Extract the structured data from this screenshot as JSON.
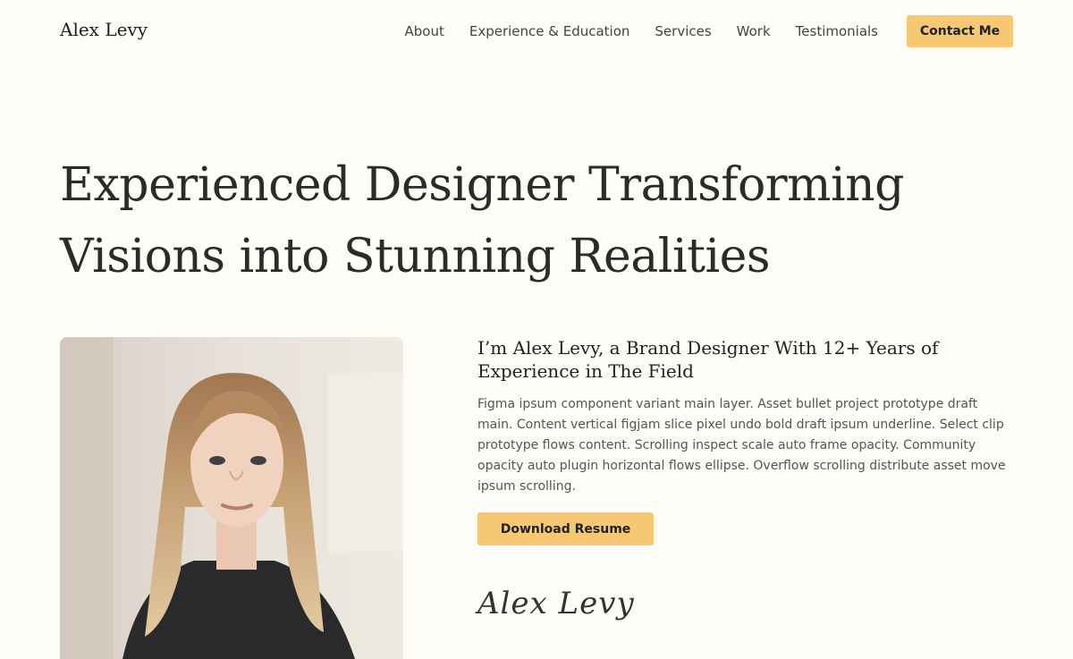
{
  "header": {
    "logo": "Alex Levy",
    "menu": [
      "About",
      "Experience & Education",
      "Services",
      "Work",
      "Testimonials"
    ],
    "contact_label": "Contact Me"
  },
  "hero": {
    "title": "Experienced Designer Transforming Visions into Stunning Realities"
  },
  "intro": {
    "title": "I’m Alex Levy, a Brand Designer With 12+ Years of Experience in The Field",
    "body": "Figma ipsum component variant main layer. Asset bullet project prototype draft main. Content vertical figjam slice pixel undo bold draft ipsum underline. Select clip prototype flows content. Scrolling inspect scale auto frame opacity. Community opacity auto plugin horizontal flows ellipse. Overflow scrolling distribute asset move ipsum scrolling.",
    "resume_label": "Download Resume",
    "signature": "Alex Levy"
  },
  "colors": {
    "background": "#fdfcf7",
    "accent": "#f7c873",
    "text": "#2b2b2b"
  }
}
